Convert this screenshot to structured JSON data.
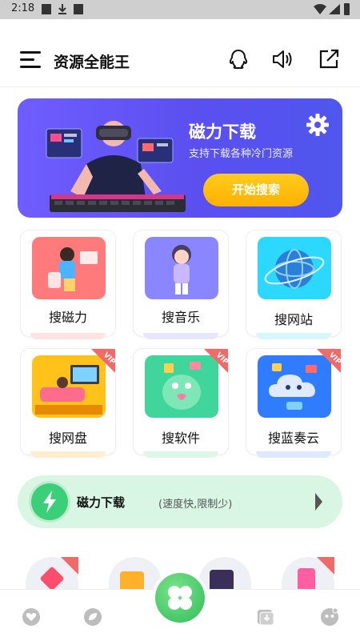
{
  "status_bar": {
    "time": "2:18"
  },
  "header": {
    "title": "资源全能王"
  },
  "banner": {
    "title": "磁力下载",
    "subtitle": "支持下载各种冷门资源",
    "button_label": "开始搜索"
  },
  "tiles": [
    {
      "label": "搜磁力",
      "vip": false
    },
    {
      "label": "搜音乐",
      "vip": false
    },
    {
      "label": "搜网站",
      "vip": false
    },
    {
      "label": "搜网盘",
      "vip": true
    },
    {
      "label": "搜软件",
      "vip": true
    },
    {
      "label": "搜蓝奏云",
      "vip": true
    }
  ],
  "magnet_bar": {
    "title": "磁力下载",
    "subtitle": "(速度快,限制少)"
  },
  "colors": {
    "accent": "#5b4ff0",
    "button": "#ffb000",
    "green": "#3ccf79",
    "vip_red": "#f06a6a"
  }
}
